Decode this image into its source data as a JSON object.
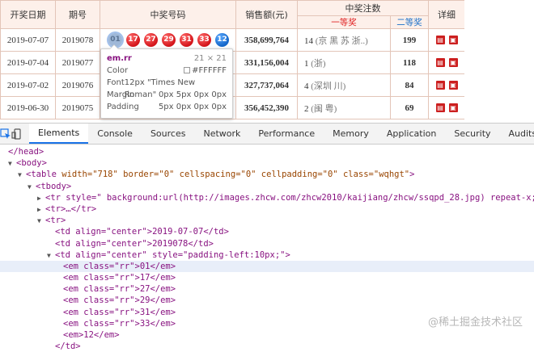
{
  "table": {
    "headers": {
      "date": "开奖日期",
      "issue": "期号",
      "numbers": "中奖号码",
      "sales": "销售额(元)",
      "prize_count": "中奖注数",
      "first": "一等奖",
      "second": "二等奖",
      "detail": "详细"
    },
    "rows": [
      {
        "date": "2019-07-07",
        "issue": "2019078",
        "balls": [
          "01",
          "17",
          "27",
          "29",
          "31",
          "33"
        ],
        "blue": "12",
        "sales": "358,699,764",
        "first_count": "14",
        "first_loc": "(京 黑 苏 浙..)",
        "second": "199"
      },
      {
        "date": "2019-07-04",
        "issue": "2019077",
        "balls": [],
        "blue": "",
        "sales": "331,156,004",
        "first_count": "1",
        "first_loc": "(浙)",
        "second": "118"
      },
      {
        "date": "2019-07-02",
        "issue": "2019076",
        "balls": [],
        "blue": "",
        "sales": "327,737,064",
        "first_count": "4",
        "first_loc": "(深圳 川)",
        "second": "84"
      },
      {
        "date": "2019-06-30",
        "issue": "2019075",
        "balls": [],
        "blue": "",
        "sales": "356,452,390",
        "first_count": "2",
        "first_loc": "(闽 粤)",
        "second": "69"
      }
    ],
    "colors": {
      "red_ball": "#d3141a",
      "blue_ball": "#1466c8",
      "sales": "#c8102e"
    }
  },
  "tooltip": {
    "selector": "em.rr",
    "size": "21 × 21",
    "color_label": "Color",
    "color_value": "#FFFFFF",
    "font_label": "Font",
    "font_value": "12px \"Times New Roman\"",
    "margin_label": "Margin",
    "margin_value": "0px 5px 0px 0px",
    "padding_label": "Padding",
    "padding_value": "5px 0px 0px 0px"
  },
  "devtools": {
    "tabs": [
      "Elements",
      "Console",
      "Sources",
      "Network",
      "Performance",
      "Memory",
      "Application",
      "Security",
      "Audits"
    ],
    "active_tab": "Elements",
    "code": {
      "l0": "</head>",
      "l1": "<body>",
      "l2_tag": "table",
      "l2_attrs": "width=\"718\" border=\"0\" cellspacing=\"0\" cellpadding=\"0\" class=\"wqhgt\"",
      "l3": "<tbody>",
      "l4": "<tr style=\" background:url(http://images.zhcw.com/zhcw2010/kaijiang/zhcw/ssqpd_28.jpg) repeat-x;\">…</t",
      "l5": "<tr>…</tr>",
      "l6": "<tr>",
      "l7": "<td align=\"center\">2019-07-07</td>",
      "l8": "<td align=\"center\">2019078</td>",
      "l9": "<td align=\"center\" style=\"padding-left:10px;\">",
      "em_lines": [
        "<em class=\"rr\">01</em>",
        "<em class=\"rr\">17</em>",
        "<em class=\"rr\">27</em>",
        "<em class=\"rr\">29</em>",
        "<em class=\"rr\">31</em>",
        "<em class=\"rr\">33</em>",
        "<em>12</em>"
      ],
      "l_end": "</td>"
    },
    "watermark": "@稀土掘金技术社区"
  }
}
